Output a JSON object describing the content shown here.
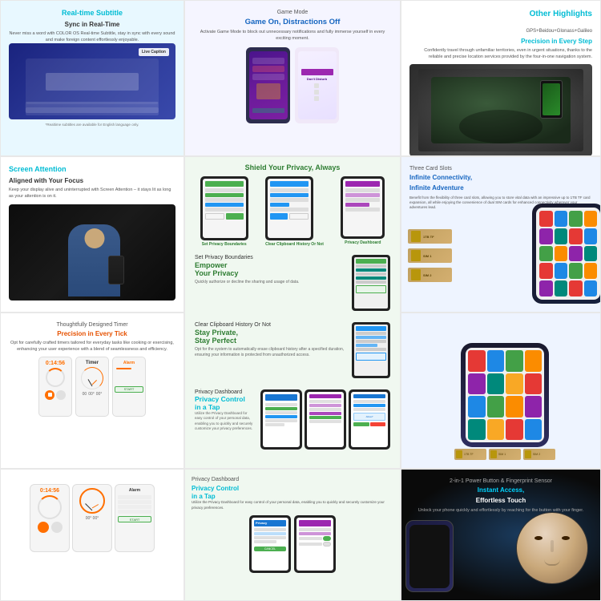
{
  "cells": {
    "realtime_subtitle": {
      "tag": "Real-time Subtitle",
      "headline": "Sync in Real-Time",
      "description": "Never miss a word with COLOR OS Real-time Subtitle, stay in sync with every sound and make foreign content effortlessly enjoyable.",
      "note": "*Realtime subtitles are available for English language only.",
      "live_caption": "Live Caption"
    },
    "game_mode": {
      "tag": "Game Mode",
      "headline": "Game On, Distractions Off",
      "description": "Activate Game Mode to block out unnecessary notifications and fully immerse yourself in every exciting moment."
    },
    "other_highlights": {
      "tag": "Other Highlights",
      "sub_tag": "GPS+Beidou+Glonass+Galileo",
      "headline": "Precision in Every Step",
      "description": "Confidently travel through unfamiliar territories, even in urgent situations, thanks to the reliable and precise location services provided by the four-in-one navigation system."
    },
    "screen_attention": {
      "tag": "Screen Attention",
      "headline": "Aligned with Your Focus",
      "description": "Keep your display alive and uninterrupted with Screen Attention – it stays lit as long as your attention is on it."
    },
    "shield_privacy": {
      "headline": "Shield Your Privacy, Always",
      "set_privacy": {
        "tag": "Set Privacy Boundaries",
        "headline_line1": "Empower",
        "headline_line2": "Your Privacy",
        "description": "Quickly authorize or decline the sharing and usage of data."
      },
      "clear_clipboard": {
        "tag": "Clear Clipboard History Or Not",
        "headline_line1": "Stay Private,",
        "headline_line2": "Stay Perfect",
        "description": "Opt for the system to automatically erase clipboard history after a specified duration, ensuring your information is protected from unauthorized access."
      },
      "privacy_dashboard": {
        "tag": "Privacy Dashboard",
        "headline_line1": "Privacy Control",
        "headline_line2": "in a Tap",
        "description": "Utilize the Privacy Dashboard for easy control of your personal data, enabling you to quickly and securely customize your privacy preferences."
      }
    },
    "three_card": {
      "tag": "Three Card Slots",
      "headline_line1": "Infinite Connectivity,",
      "headline_line2": "Infinite Adventure",
      "description": "Benefit from the flexibility of three card slots, allowing you to store vital data with an impressive up to 1TB TF card expansion, all while enjoying the convenience of dual SIM cards for enhanced connectivity wherever your adventures lead."
    },
    "timer": {
      "tag": "Thoughtfully Designed Timer",
      "headline": "Precision in Every Tick",
      "description": "Opt for carefully crafted timers tailored for everyday tasks like cooking or exercising, enhancing your user experience with a blend of seamlessness and efficiency.",
      "display": "0:14:56"
    },
    "infinite_connectivity": {
      "tag": "Three Card Slots",
      "headline_line1": "Infinite Connectivity,",
      "headline_line2": "Infinite Adventure",
      "sim1": "1TB TF",
      "sim2": "SIM 1",
      "sim3": "SIM 2"
    },
    "power_button": {
      "tag": "2-in-1 Power Button & Fingerprint Sensor",
      "headline_line1": "Instant Access,",
      "headline_line2": "Effortless Touch",
      "description": "Unlock your phone quickly and effortlessly by reaching for the button with your finger."
    }
  }
}
